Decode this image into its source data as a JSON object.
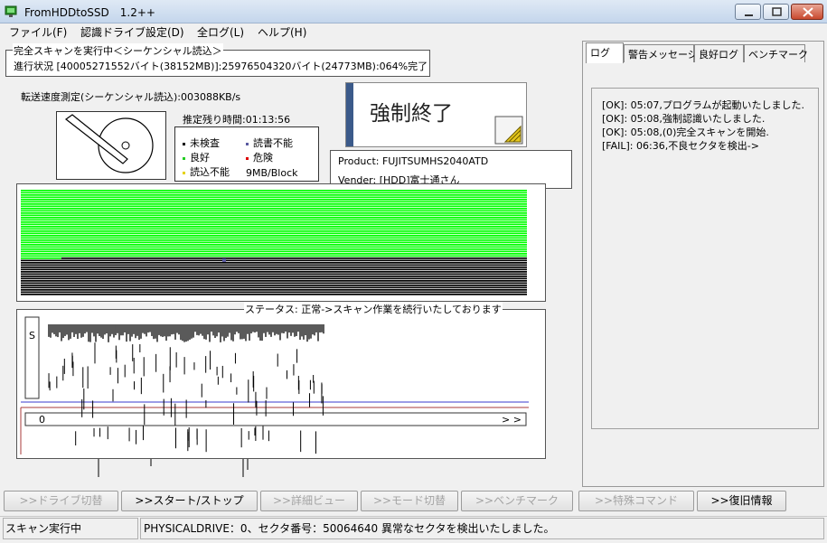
{
  "window": {
    "title": "FromHDDtoSSD　1.2++"
  },
  "menu": [
    "ファイル(F)",
    "認識ドライブ設定(D)",
    "全ログ(L)",
    "ヘルプ(H)"
  ],
  "scan": {
    "title": "完全スキャンを実行中＜シーケンシャル読込＞",
    "progress": "進行状況 [40005271552バイト(38152MB)]:25976504320バイト(24773MB):064%完了",
    "progress_percent": 64,
    "speed": "転送速度測定(シーケンシャル読込):003088KB/s",
    "remaining": "推定残り時間:01:13:56"
  },
  "legend": {
    "unchecked": "未検査",
    "unreadable_write": "読書不能",
    "good": "良好",
    "danger": "危険",
    "unreadable": "読込不能",
    "block_size": "9MB/Block",
    "colors": {
      "unchecked": "#000000",
      "unreadable_write": "#5a5aa0",
      "good": "#22cc22",
      "danger": "#dd0000",
      "unreadable": "#e6d200"
    }
  },
  "force_quit": {
    "label": "強制終了"
  },
  "drive": {
    "product": "Product: FUJITSUMHS2040ATD",
    "vendor": "Vender: [HDD]富士通さん"
  },
  "map": {
    "green_color": "#00ff00",
    "black_color": "#000000"
  },
  "status": {
    "title": "ステータス: 正常->スキャン作業を続行いたしております",
    "s_label": "S",
    "axis_start": "0",
    "axis_end": "> >"
  },
  "tabs": [
    "ログ",
    "警告メッセージ",
    "良好ログ",
    "ベンチマーク"
  ],
  "log_lines": [
    "[OK]: 05:07,プログラムが起動いたしました.",
    "[OK]: 05:08,強制認識いたしました.",
    "[OK]: 05:08,(0)完全スキャンを開始.",
    "[FAIL]: 06:36,不良セクタを検出->"
  ],
  "buttons": {
    "drive_switch": ">>ドライブ切替",
    "start_stop": ">>スタート/ストップ",
    "detail_view": ">>詳細ビュー",
    "mode_switch": ">>モード切替",
    "benchmark": ">>ベンチマーク",
    "special_command": ">>特殊コマンド",
    "restore_info": ">>復旧情報"
  },
  "statusbar": {
    "left": "スキャン実行中",
    "right": "PHYSICALDRIVE：0、セクタ番号：50064640 異常なセクタを検出いたしました。"
  }
}
